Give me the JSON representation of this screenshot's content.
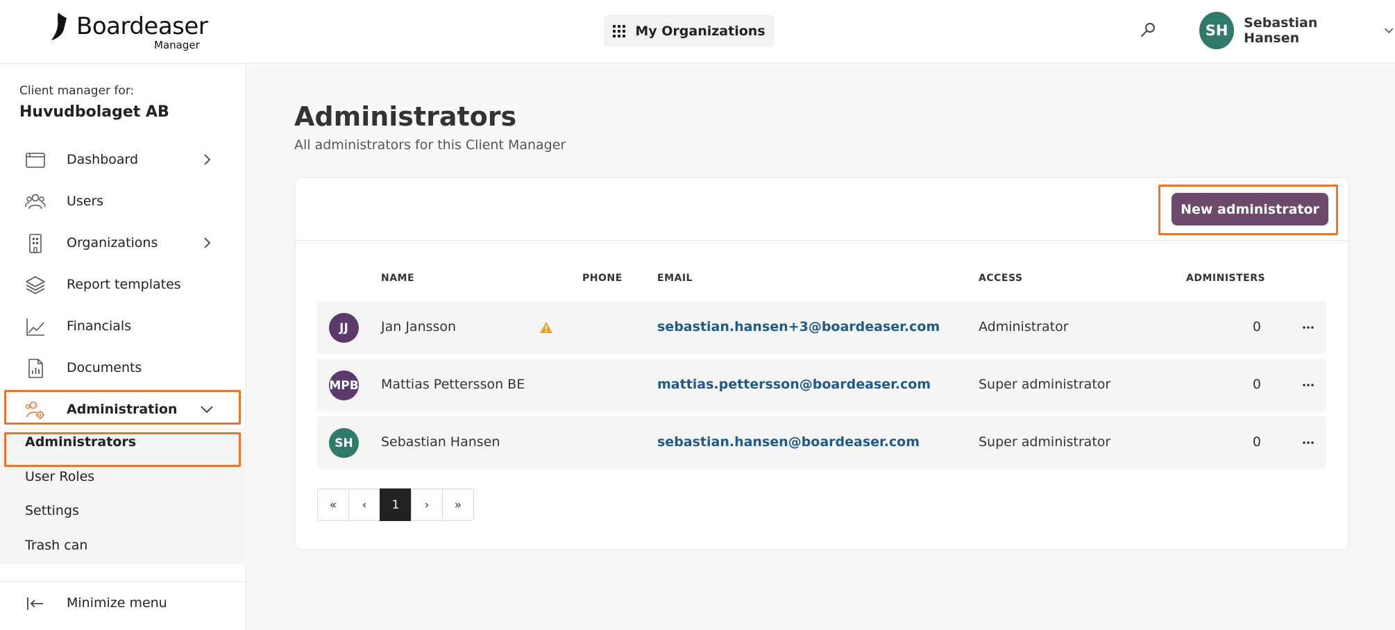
{
  "header": {
    "logo_name": "Boardeaser",
    "logo_sub": "Manager",
    "org_button": "My Organizations",
    "user_initials": "SH",
    "user_name": "Sebastian Hansen",
    "colors": {
      "avatar": "#2f7a6a"
    }
  },
  "sidebar": {
    "client_manager_for": "Client manager for:",
    "client_name": "Huvudbolaget AB",
    "items": [
      {
        "label": "Dashboard",
        "icon": "browser-window-icon",
        "has_chevron": true
      },
      {
        "label": "Users",
        "icon": "users-icon"
      },
      {
        "label": "Organizations",
        "icon": "building-icon",
        "has_chevron": true
      },
      {
        "label": "Report templates",
        "icon": "layers-icon"
      },
      {
        "label": "Financials",
        "icon": "line-chart-icon"
      },
      {
        "label": "Documents",
        "icon": "document-chart-icon"
      },
      {
        "label": "Administration",
        "icon": "users-gear-icon",
        "expanded": true,
        "active": true
      }
    ],
    "sub_items": [
      {
        "label": "Administrators",
        "active": true
      },
      {
        "label": "User Roles"
      },
      {
        "label": "Settings"
      },
      {
        "label": "Trash can"
      }
    ],
    "minimize": "Minimize menu",
    "highlight_color": "#e8742f"
  },
  "main": {
    "title": "Administrators",
    "subtitle": "All administrators for this Client Manager",
    "new_button": "New administrator",
    "button_color": "#6d4a6b",
    "columns": {
      "name": "NAME",
      "phone": "PHONE",
      "email": "EMAIL",
      "access": "ACCESS",
      "administers": "ADMINISTERS"
    },
    "rows": [
      {
        "initials": "JJ",
        "avatar_color": "#5b3a6b",
        "name": "Jan Jansson",
        "warning": true,
        "phone": "",
        "email": "sebastian.hansen+3@boardeaser.com",
        "access": "Administrator",
        "administers": "0"
      },
      {
        "initials": "MPB",
        "avatar_color": "#5b3a6b",
        "name": "Mattias Pettersson BE",
        "warning": false,
        "phone": "",
        "email": "mattias.pettersson@boardeaser.com",
        "access": "Super administrator",
        "administers": "0"
      },
      {
        "initials": "SH",
        "avatar_color": "#2f7a6a",
        "name": "Sebastian Hansen",
        "warning": false,
        "phone": "",
        "email": "sebastian.hansen@boardeaser.com",
        "access": "Super administrator",
        "administers": "0"
      }
    ],
    "pagination": {
      "first": "«",
      "prev": "‹",
      "current": "1",
      "next": "›",
      "last": "»"
    }
  }
}
